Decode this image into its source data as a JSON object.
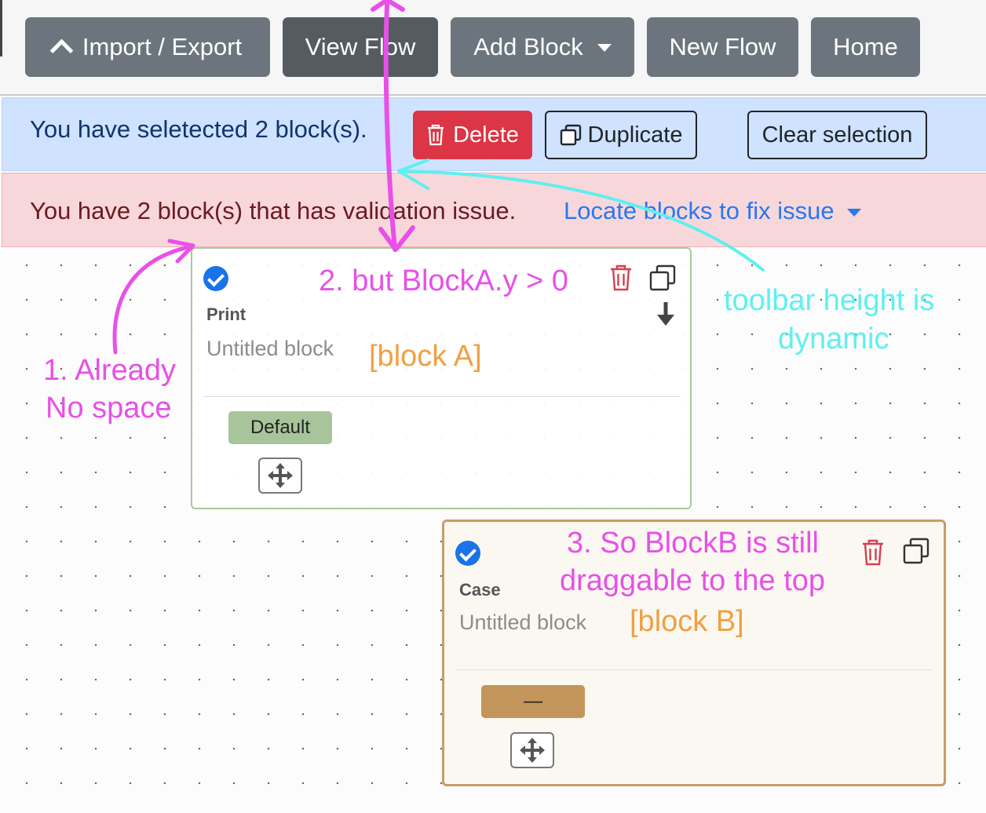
{
  "toolbar": {
    "import_export": "Import / Export",
    "view_flow": "View Flow",
    "add_block": "Add Block",
    "new_flow": "New Flow",
    "home": "Home"
  },
  "selection": {
    "message": "You have seletected 2 block(s).",
    "delete": "Delete",
    "duplicate": "Duplicate",
    "clear": "Clear selection"
  },
  "validation": {
    "message": "You have 2 block(s) that has validation issue.",
    "locate": "Locate blocks to fix issue"
  },
  "blocks": [
    {
      "type": "Print",
      "name": "Untitled block",
      "exit": "Default",
      "tag": "[block A]",
      "exit_color": "#a8c49a"
    },
    {
      "type": "Case",
      "name": "Untitled block",
      "exit": "—",
      "tag": "[block B]",
      "exit_color": "#c4955a"
    }
  ],
  "annotations": {
    "note1_line1": "1. Already",
    "note1_line2": "No space",
    "note2": "2. but BlockA.y > 0",
    "note3_line1": "3. So BlockB is still",
    "note3_line2": "draggable to the top",
    "toolbar_line1": "toolbar height is",
    "toolbar_line2": "dynamic"
  },
  "colors": {
    "annotation_pink": "#e850e8",
    "annotation_cyan": "#5ef0f0",
    "annotation_orange": "#f0a040",
    "danger": "#dc3545",
    "link": "#2878f0"
  }
}
